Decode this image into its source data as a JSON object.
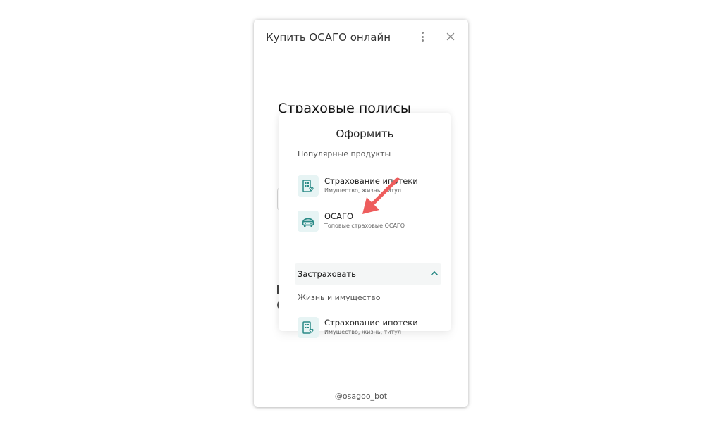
{
  "window": {
    "title": "Купить ОСАГО онлайн",
    "menu_icon": "kebab-menu-icon",
    "close_icon": "close-icon"
  },
  "page": {
    "heading": "Страховые полисы"
  },
  "dropdown": {
    "title": "Оформить",
    "popular_label": "Популярные продукты",
    "popular_items": [
      {
        "name": "Страхование ипотеки",
        "subtitle": "Имущество, жизнь, титул",
        "icon": "mortgage-building-icon"
      },
      {
        "name": "ОСАГО",
        "subtitle": "Топовые страховые ОСАГО",
        "icon": "car-insurance-icon"
      }
    ],
    "accordion": {
      "label": "Застраховать",
      "state": "expanded"
    },
    "life_label": "Жизнь и имущество",
    "life_items": [
      {
        "name": "Страхование ипотеки",
        "subtitle": "Имущество, жизнь, титул",
        "icon": "mortgage-building-icon"
      }
    ]
  },
  "footer": {
    "handle": "@osagoo_bot"
  },
  "colors": {
    "accent": "#2a8a86",
    "icon_bg": "#e7f4f4",
    "arrow": "#ee5d5d"
  }
}
